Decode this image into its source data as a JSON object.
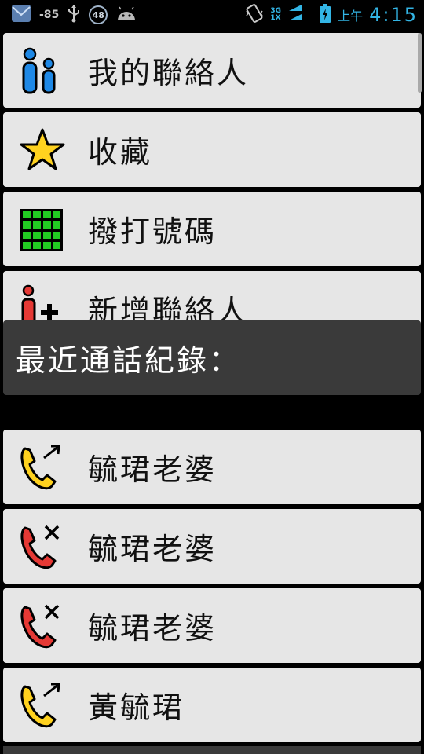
{
  "status_bar": {
    "signal_strength": "-85",
    "battery_percent": "48",
    "network_top": "3G",
    "network_bottom": "1X",
    "ampm": "上午",
    "time": "4:15",
    "accent_color": "#33b5e5"
  },
  "menu": {
    "items": [
      {
        "label": "我的聯絡人",
        "icon": "contacts-icon"
      },
      {
        "label": "收藏",
        "icon": "star-icon"
      },
      {
        "label": "撥打號碼",
        "icon": "dialpad-icon"
      },
      {
        "label": "新增聯絡人",
        "icon": "add-contact-icon"
      }
    ]
  },
  "recent": {
    "header": "最近通話紀錄：",
    "calls": [
      {
        "name": "毓珺老婆",
        "type": "outgoing",
        "icon": "outgoing-call-icon"
      },
      {
        "name": "毓珺老婆",
        "type": "missed",
        "icon": "missed-call-icon"
      },
      {
        "name": "毓珺老婆",
        "type": "missed",
        "icon": "missed-call-icon"
      },
      {
        "name": "黃毓珺",
        "type": "outgoing",
        "icon": "outgoing-call-icon"
      }
    ]
  }
}
